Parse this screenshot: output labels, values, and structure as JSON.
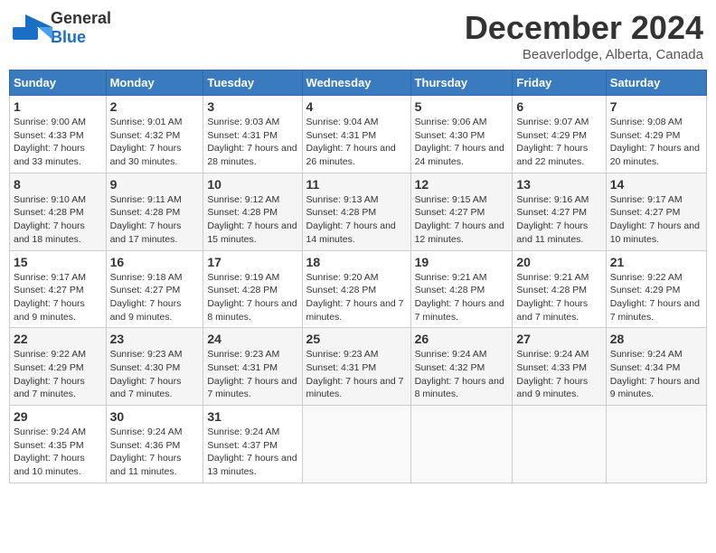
{
  "logo": {
    "general": "General",
    "blue": "Blue"
  },
  "title": "December 2024",
  "location": "Beaverlodge, Alberta, Canada",
  "headers": [
    "Sunday",
    "Monday",
    "Tuesday",
    "Wednesday",
    "Thursday",
    "Friday",
    "Saturday"
  ],
  "weeks": [
    [
      {
        "day": "1",
        "sunrise": "9:00 AM",
        "sunset": "4:33 PM",
        "daylight": "7 hours and 33 minutes."
      },
      {
        "day": "2",
        "sunrise": "9:01 AM",
        "sunset": "4:32 PM",
        "daylight": "7 hours and 30 minutes."
      },
      {
        "day": "3",
        "sunrise": "9:03 AM",
        "sunset": "4:31 PM",
        "daylight": "7 hours and 28 minutes."
      },
      {
        "day": "4",
        "sunrise": "9:04 AM",
        "sunset": "4:31 PM",
        "daylight": "7 hours and 26 minutes."
      },
      {
        "day": "5",
        "sunrise": "9:06 AM",
        "sunset": "4:30 PM",
        "daylight": "7 hours and 24 minutes."
      },
      {
        "day": "6",
        "sunrise": "9:07 AM",
        "sunset": "4:29 PM",
        "daylight": "7 hours and 22 minutes."
      },
      {
        "day": "7",
        "sunrise": "9:08 AM",
        "sunset": "4:29 PM",
        "daylight": "7 hours and 20 minutes."
      }
    ],
    [
      {
        "day": "8",
        "sunrise": "9:10 AM",
        "sunset": "4:28 PM",
        "daylight": "7 hours and 18 minutes."
      },
      {
        "day": "9",
        "sunrise": "9:11 AM",
        "sunset": "4:28 PM",
        "daylight": "7 hours and 17 minutes."
      },
      {
        "day": "10",
        "sunrise": "9:12 AM",
        "sunset": "4:28 PM",
        "daylight": "7 hours and 15 minutes."
      },
      {
        "day": "11",
        "sunrise": "9:13 AM",
        "sunset": "4:28 PM",
        "daylight": "7 hours and 14 minutes."
      },
      {
        "day": "12",
        "sunrise": "9:15 AM",
        "sunset": "4:27 PM",
        "daylight": "7 hours and 12 minutes."
      },
      {
        "day": "13",
        "sunrise": "9:16 AM",
        "sunset": "4:27 PM",
        "daylight": "7 hours and 11 minutes."
      },
      {
        "day": "14",
        "sunrise": "9:17 AM",
        "sunset": "4:27 PM",
        "daylight": "7 hours and 10 minutes."
      }
    ],
    [
      {
        "day": "15",
        "sunrise": "9:17 AM",
        "sunset": "4:27 PM",
        "daylight": "7 hours and 9 minutes."
      },
      {
        "day": "16",
        "sunrise": "9:18 AM",
        "sunset": "4:27 PM",
        "daylight": "7 hours and 9 minutes."
      },
      {
        "day": "17",
        "sunrise": "9:19 AM",
        "sunset": "4:28 PM",
        "daylight": "7 hours and 8 minutes."
      },
      {
        "day": "18",
        "sunrise": "9:20 AM",
        "sunset": "4:28 PM",
        "daylight": "7 hours and 7 minutes."
      },
      {
        "day": "19",
        "sunrise": "9:21 AM",
        "sunset": "4:28 PM",
        "daylight": "7 hours and 7 minutes."
      },
      {
        "day": "20",
        "sunrise": "9:21 AM",
        "sunset": "4:28 PM",
        "daylight": "7 hours and 7 minutes."
      },
      {
        "day": "21",
        "sunrise": "9:22 AM",
        "sunset": "4:29 PM",
        "daylight": "7 hours and 7 minutes."
      }
    ],
    [
      {
        "day": "22",
        "sunrise": "9:22 AM",
        "sunset": "4:29 PM",
        "daylight": "7 hours and 7 minutes."
      },
      {
        "day": "23",
        "sunrise": "9:23 AM",
        "sunset": "4:30 PM",
        "daylight": "7 hours and 7 minutes."
      },
      {
        "day": "24",
        "sunrise": "9:23 AM",
        "sunset": "4:31 PM",
        "daylight": "7 hours and 7 minutes."
      },
      {
        "day": "25",
        "sunrise": "9:23 AM",
        "sunset": "4:31 PM",
        "daylight": "7 hours and 7 minutes."
      },
      {
        "day": "26",
        "sunrise": "9:24 AM",
        "sunset": "4:32 PM",
        "daylight": "7 hours and 8 minutes."
      },
      {
        "day": "27",
        "sunrise": "9:24 AM",
        "sunset": "4:33 PM",
        "daylight": "7 hours and 9 minutes."
      },
      {
        "day": "28",
        "sunrise": "9:24 AM",
        "sunset": "4:34 PM",
        "daylight": "7 hours and 9 minutes."
      }
    ],
    [
      {
        "day": "29",
        "sunrise": "9:24 AM",
        "sunset": "4:35 PM",
        "daylight": "7 hours and 10 minutes."
      },
      {
        "day": "30",
        "sunrise": "9:24 AM",
        "sunset": "4:36 PM",
        "daylight": "7 hours and 11 minutes."
      },
      {
        "day": "31",
        "sunrise": "9:24 AM",
        "sunset": "4:37 PM",
        "daylight": "7 hours and 13 minutes."
      },
      null,
      null,
      null,
      null
    ]
  ]
}
